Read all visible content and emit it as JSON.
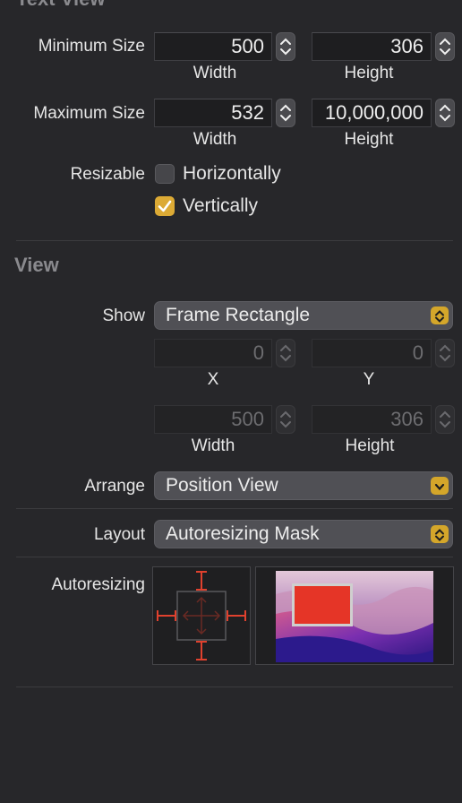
{
  "section_text_view": {
    "title": "Text View"
  },
  "minimum_size": {
    "label": "Minimum Size",
    "width_value": "500",
    "width_label": "Width",
    "height_value": "306",
    "height_label": "Height"
  },
  "maximum_size": {
    "label": "Maximum Size",
    "width_value": "532",
    "width_label": "Width",
    "height_value": "10,000,000",
    "height_label": "Height"
  },
  "resizable": {
    "label": "Resizable",
    "horizontally": {
      "label": "Horizontally",
      "checked": false
    },
    "vertically": {
      "label": "Vertically",
      "checked": true
    }
  },
  "section_view": {
    "title": "View"
  },
  "show": {
    "label": "Show",
    "selected": "Frame Rectangle",
    "x_value": "0",
    "x_label": "X",
    "y_value": "0",
    "y_label": "Y",
    "width_value": "500",
    "width_label": "Width",
    "height_value": "306",
    "height_label": "Height"
  },
  "arrange": {
    "label": "Arrange",
    "selected": "Position View"
  },
  "layout": {
    "label": "Layout",
    "selected": "Autoresizing Mask"
  },
  "autoresizing": {
    "label": "Autoresizing"
  },
  "colors": {
    "background": "#27272a",
    "accent": "#dcaa35",
    "spring": "#e0412e",
    "preview_view": "#e53527"
  }
}
